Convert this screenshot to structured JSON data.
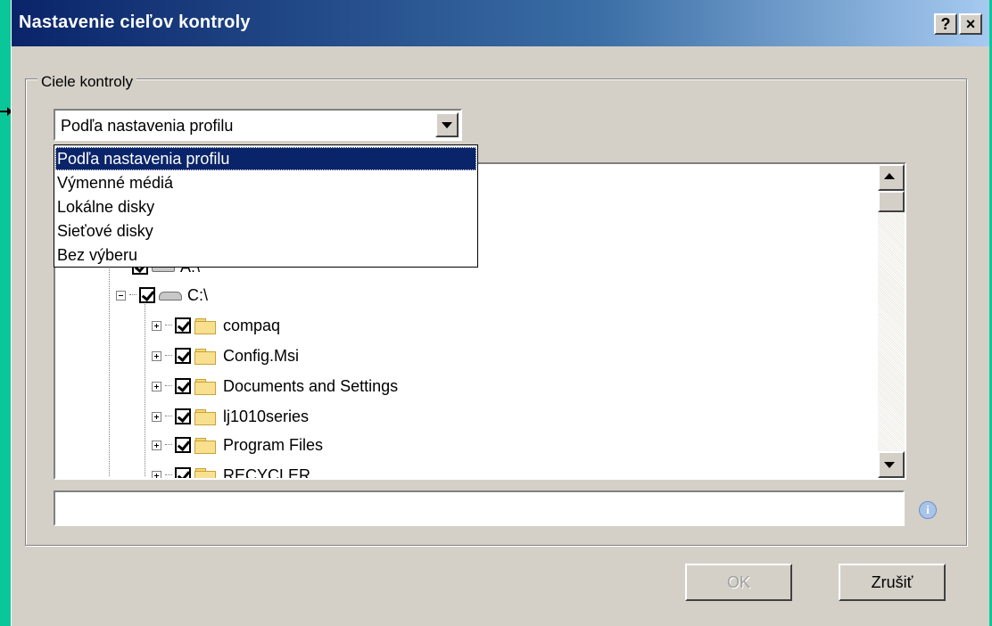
{
  "window": {
    "title": "Nastavenie cieľov kontroly",
    "help_label": "?",
    "close_label": "×"
  },
  "group": {
    "label": "Ciele kontroly"
  },
  "combo": {
    "selected": "Podľa nastavenia profilu",
    "options": [
      "Podľa nastavenia profilu",
      "Výmenné médiá",
      "Lokálne disky",
      "Sieťové disky",
      "Bez výberu"
    ]
  },
  "tree": {
    "drives": [
      {
        "label": "A:\\"
      },
      {
        "label": "C:\\"
      }
    ],
    "folders": [
      {
        "label": "compaq"
      },
      {
        "label": "Config.Msi"
      },
      {
        "label": "Documents and Settings"
      },
      {
        "label": "lj1010series"
      },
      {
        "label": "Program Files"
      },
      {
        "label": "RECYCLER"
      }
    ]
  },
  "path_field": {
    "value": ""
  },
  "buttons": {
    "ok_label": "OK",
    "cancel_label": "Zrušiť"
  },
  "colors": {
    "background": "#0ac79a",
    "selection": "#0a246a",
    "title_gradient_start": "#0a246a",
    "title_gradient_end": "#a6caf0"
  }
}
